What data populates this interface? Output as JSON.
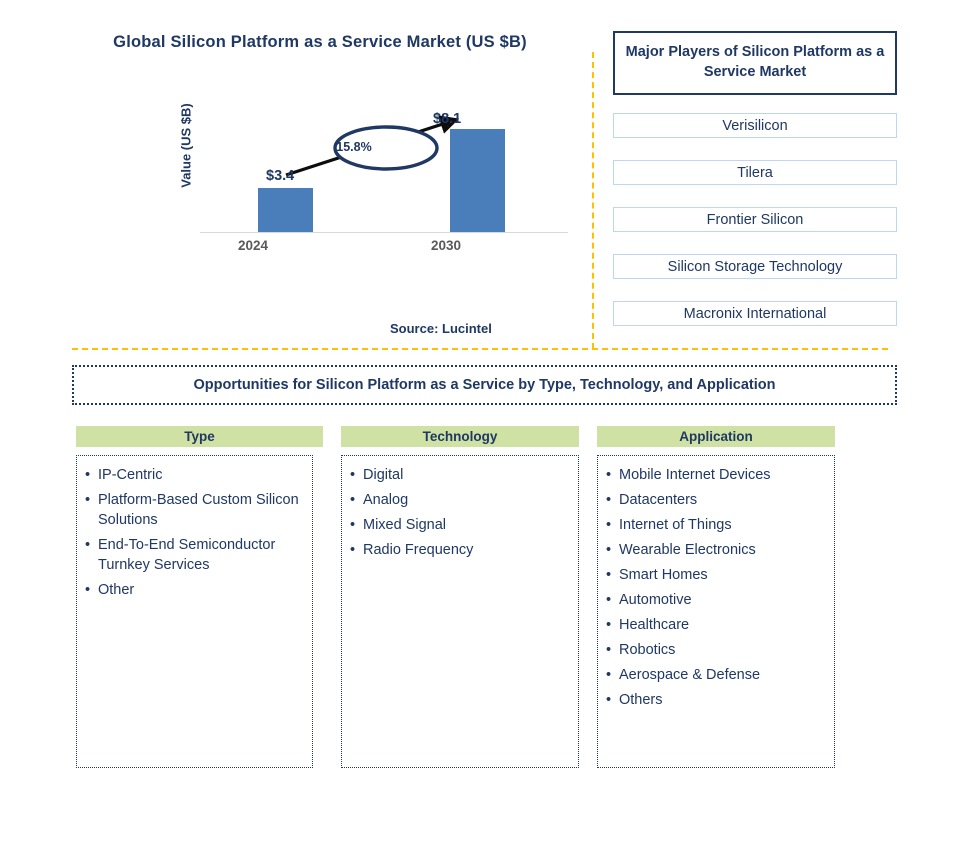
{
  "chart": {
    "title": "Global Silicon Platform as a Service Market (US $B)",
    "y_axis_label": "Value (US $B)",
    "cagr_label": "15.8%",
    "value_2024": "$3.4",
    "value_2030": "$8.1",
    "tick_2024": "2024",
    "tick_2030": "2030",
    "bar_color": "#4A7EBB"
  },
  "chart_data": {
    "type": "bar",
    "title": "Global Silicon Platform as a Service Market (US $B)",
    "xlabel": "",
    "ylabel": "Value (US $B)",
    "categories": [
      "2024",
      "2030"
    ],
    "values": [
      3.4,
      8.1
    ],
    "data_labels": [
      "$3.4",
      "$8.1"
    ],
    "ylim": [
      0,
      9.8
    ],
    "grid": false,
    "legend": "none",
    "annotations": [
      {
        "text": "15.8%",
        "type": "cagr-callout",
        "from": "2024",
        "to": "2030"
      }
    ],
    "series_color": "#4A7EBB"
  },
  "source": {
    "label": "Source: Lucintel"
  },
  "players": {
    "header": "Major Players of Silicon Platform as a Service Market",
    "items": [
      "Verisilicon",
      "Tilera",
      "Frontier Silicon",
      "Silicon Storage Technology",
      "Macronix International"
    ]
  },
  "opportunities": {
    "banner": "Opportunities for Silicon Platform as a Service by Type, Technology, and Application",
    "columns": [
      {
        "header": "Type",
        "items": [
          "IP-Centric",
          "Platform-Based Custom Silicon Solutions",
          "End-To-End Semiconductor Turnkey Services",
          "Other"
        ]
      },
      {
        "header": "Technology",
        "items": [
          "Digital",
          "Analog",
          "Mixed Signal",
          "Radio Frequency"
        ]
      },
      {
        "header": "Application",
        "items": [
          "Mobile Internet Devices",
          "Datacenters",
          "Internet of Things",
          "Wearable Electronics",
          "Smart Homes",
          "Automotive",
          "Healthcare",
          "Robotics",
          "Aerospace & Defense",
          "Others"
        ]
      }
    ]
  },
  "colors": {
    "navy": "#1F3864",
    "bar_blue": "#4A7EBB",
    "divider_orange": "#FFC000",
    "header_green": "#CFE2A3",
    "player_border": "#BDD7EE"
  }
}
